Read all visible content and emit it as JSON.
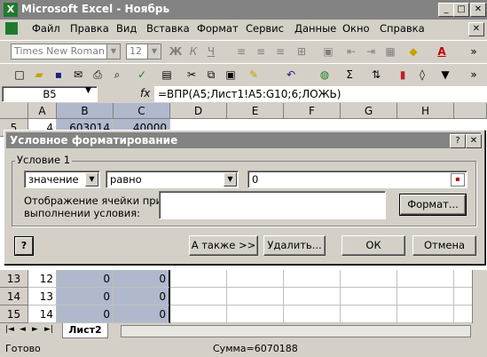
{
  "app": {
    "title": "Microsoft Excel - Ноябрь",
    "logo_letter": "X",
    "win_min": "_",
    "win_max": "□",
    "win_close": "✕"
  },
  "menu": [
    "Файл",
    "Правка",
    "Вид",
    "Вставка",
    "Формат",
    "Сервис",
    "Данные",
    "Окно",
    "Справка"
  ],
  "menu_close": "✕",
  "format_toolbar": {
    "font": "Times New Roman",
    "size": "12",
    "bold": "Ж",
    "italic": "К",
    "underline": "Ч"
  },
  "formula_bar": {
    "name_box": "B5",
    "fx": "fx",
    "formula": "=ВПР(A5;Лист1!A5:G10;6;ЛОЖЬ)"
  },
  "sheet": {
    "columns": [
      "A",
      "B",
      "C",
      "D",
      "E",
      "F",
      "G",
      "H"
    ],
    "top_row": {
      "num": "5",
      "a": "4",
      "b": "603014",
      "c": "40000"
    },
    "rows": [
      {
        "num": "13",
        "a": "12",
        "b": "0",
        "c": "0"
      },
      {
        "num": "14",
        "a": "13",
        "b": "0",
        "c": "0"
      },
      {
        "num": "15",
        "a": "14",
        "b": "0",
        "c": "0"
      }
    ],
    "tab": "Лист2"
  },
  "dialog": {
    "title": "Условное форматирование",
    "help_btn": "?",
    "close_btn": "✕",
    "condition_label": "Условие 1",
    "operand_select": "значение",
    "operator_select": "равно",
    "value_input": "0",
    "preview_label_line1": "Отображение ячейки при",
    "preview_label_line2": "выполнении условия:",
    "format_button": "Формат...",
    "help_icon": "?",
    "also_button": "А также >>",
    "delete_button": "Удалить...",
    "ok_button": "ОК",
    "cancel_button": "Отмена"
  },
  "status": {
    "ready": "Готово",
    "sum": "Сумма=6070188"
  }
}
